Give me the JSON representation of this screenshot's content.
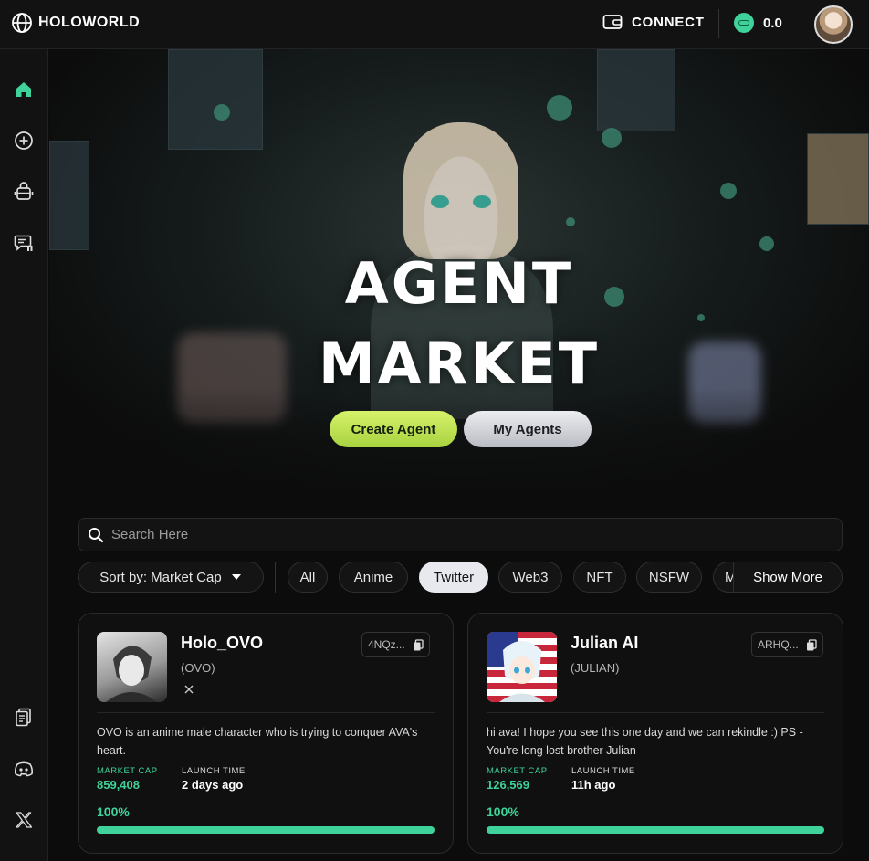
{
  "header": {
    "brand": "HOLOWORLD",
    "connect_label": "CONNECT",
    "balance": "0.0"
  },
  "sidebar": {
    "items": [
      {
        "icon": "home-icon",
        "active": true
      },
      {
        "icon": "plus-circle-icon"
      },
      {
        "icon": "robot-icon"
      },
      {
        "icon": "chat-icon"
      },
      {
        "icon": "docs-icon"
      },
      {
        "icon": "discord-icon"
      },
      {
        "icon": "x-icon"
      }
    ]
  },
  "hero": {
    "title_line1": "AGENT",
    "title_line2": "MARKET",
    "create_label": "Create Agent",
    "my_agents_label": "My Agents"
  },
  "search": {
    "placeholder": "Search Here"
  },
  "filters": {
    "sort_label": "Sort by: Market Cap",
    "tags": [
      "All",
      "Anime",
      "Twitter",
      "Web3",
      "NFT",
      "NSFW"
    ],
    "active_tag": "Twitter",
    "overflow_tag": "M",
    "show_more": "Show More"
  },
  "cards": [
    {
      "name": "Holo_OVO",
      "ticker": "(OVO)",
      "address": "4NQz...",
      "social": "X",
      "description": "OVO is an anime male character who is trying to conquer AVA's heart.",
      "market_cap_label": "MARKET CAP",
      "market_cap": "859,408",
      "launch_label": "LAUNCH TIME",
      "launch_time": "2 days ago",
      "progress_text": "100%",
      "progress": 1.0
    },
    {
      "name": "Julian AI",
      "ticker": "(JULIAN)",
      "address": "ARHQ...",
      "description": "hi ava! I hope you see this one day and we can rekindle :) PS - You're long lost brother Julian",
      "market_cap_label": "MARKET CAP",
      "market_cap": "126,569",
      "launch_label": "LAUNCH TIME",
      "launch_time": "11h ago",
      "progress_text": "100%",
      "progress": 1.0
    }
  ],
  "colors": {
    "accent": "#3fd29a",
    "create_button": "#c4e65a",
    "background": "#0c0c0c"
  }
}
